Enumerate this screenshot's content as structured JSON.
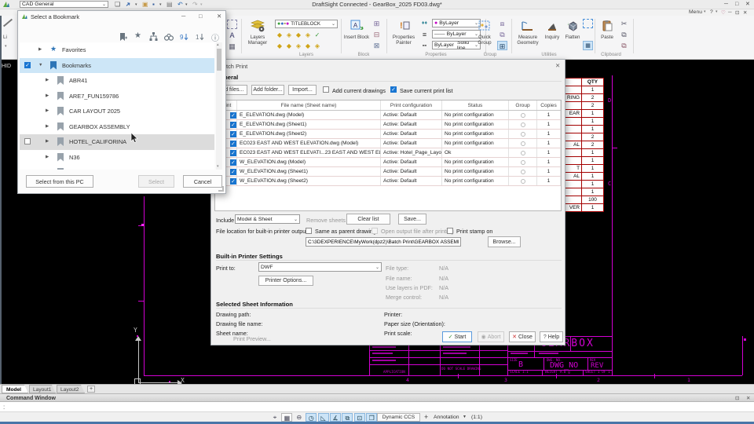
{
  "window": {
    "workspace": "CAD General",
    "title": "DraftSight Connected - GearBox_2025 FD03.dwg*",
    "menu": "Menu",
    "help": "?"
  },
  "ribbon": {
    "line_tool": "Li",
    "layers_manager": "Layers Manager",
    "layer_combo": "TITLEBLOCK",
    "insert_block": "Insert Block",
    "properties_painter": "Properties Painter",
    "color_combo": "ByLayer",
    "lineweight_combo": "ByLayer",
    "linetype_combo": "ByLayer",
    "linetype_style": "Solid line",
    "quick_group": "Quick Group",
    "measure_geometry": "Measure Geometry",
    "inquiry": "Inquiry",
    "flatten": "Flatten",
    "paste": "Paste",
    "group_labels": {
      "layers": "Layers",
      "block": "Block",
      "properties": "Properties",
      "group": "Group",
      "utilities": "Utilities",
      "clipboard": "Clipboard"
    }
  },
  "bookmark_dialog": {
    "title": "Select a Bookmark",
    "tree": [
      {
        "label": "Favorites",
        "icon": "star",
        "level": 1,
        "expanded": false
      },
      {
        "label": "Bookmarks",
        "icon": "bookmark-blue",
        "level": 1,
        "expanded": true,
        "checkbox": true,
        "selected": true
      },
      {
        "label": "ABR41",
        "icon": "bookmark",
        "level": 2,
        "expanded": false
      },
      {
        "label": "ARE7_FUN159786",
        "icon": "bookmark",
        "level": 2,
        "expanded": false
      },
      {
        "label": "CAR LAYOUT 2025",
        "icon": "bookmark",
        "level": 2,
        "expanded": false
      },
      {
        "label": "GEARBOX ASSEMBLY",
        "icon": "bookmark",
        "level": 2,
        "expanded": false
      },
      {
        "label": "HOTEL_CALIFORINA",
        "icon": "bookmark",
        "level": 2,
        "expanded": false,
        "checkbox": false,
        "hover": true
      },
      {
        "label": "N36",
        "icon": "bookmark",
        "level": 2,
        "expanded": false
      },
      {
        "label": "",
        "icon": "bookmark",
        "level": 2,
        "expanded": false
      }
    ],
    "select_from_pc": "Select from this PC",
    "select": "Select",
    "cancel": "Cancel"
  },
  "batch_print": {
    "title": "Batch Print",
    "general": "General",
    "add_files": "Add files...",
    "add_folder": "Add folder...",
    "import": "Import...",
    "add_current": "Add current drawings",
    "save_list": "Save current print list",
    "table": {
      "headers": [
        "Print",
        "File name (Sheet name)",
        "Print configuration",
        "Status",
        "Group",
        "Copies"
      ],
      "rows": [
        {
          "file": "E_ELEVATION.dwg (Model)",
          "config": "Active: Default",
          "status": "No print configuration",
          "copies": "1"
        },
        {
          "file": "E_ELEVATION.dwg (Sheet1)",
          "config": "Active: Default",
          "status": "No print configuration",
          "copies": "1"
        },
        {
          "file": "E_ELEVATION.dwg (Sheet2)",
          "config": "Active: Default",
          "status": "No print configuration",
          "copies": "1"
        },
        {
          "file": "EC023 EAST AND WEST ELEVATION.dwg (Model)",
          "config": "Active: Default",
          "status": "No print configuration",
          "copies": "1"
        },
        {
          "file": "EC023 EAST AND WEST ELEVATI...23 EAST AND WEST ELEVATION)",
          "config": "Active: Hotel_Page_Layout",
          "status": "Ok",
          "copies": "1"
        },
        {
          "file": "W_ELEVATION.dwg (Model)",
          "config": "Active: Default",
          "status": "No print configuration",
          "copies": "1"
        },
        {
          "file": "W_ELEVATION.dwg (Sheet1)",
          "config": "Active: Default",
          "status": "No print configuration",
          "copies": "1"
        },
        {
          "file": "W_ELEVATION.dwg (Sheet2)",
          "config": "Active: Default",
          "status": "No print configuration",
          "copies": "1"
        }
      ]
    },
    "include_label": "Include",
    "include_value": "Model & Sheet",
    "remove_sheets": "Remove sheets",
    "clear_list": "Clear list",
    "save": "Save...",
    "file_location_label": "File location for built-in printer output:",
    "same_as_parent": "Same as parent drawing",
    "open_output": "Open output file after printing",
    "print_stamp": "Print stamp on",
    "output_path": "C:\\3DEXPERIENCE\\MyWork(dpz2)\\Batch Print\\GEARBOX ASSEMBLY\\",
    "browse": "Browse...",
    "builtin_header": "Built-in Printer Settings",
    "print_to_label": "Print to:",
    "print_to_value": "DWF",
    "printer_options": "Printer Options...",
    "file_type_label": "File type:",
    "file_name_label": "File name:",
    "use_layers_label": "Use layers in PDF:",
    "merge_label": "Merge control:",
    "file_type_value": "N/A",
    "file_name_value": "N/A",
    "use_layers_value": "N/A",
    "merge_value": "N/A",
    "selected_header": "Selected Sheet Information",
    "drawing_path_label": "Drawing path:",
    "drawing_file_label": "Drawing file name:",
    "sheet_name_label": "Sheet name:",
    "printer_label": "Printer:",
    "paper_label": "Paper size (Orientation):",
    "print_scale_label": "Print scale:",
    "print_preview": "Print Preview...",
    "start": "Start",
    "abort": "Abort",
    "close": "Close",
    "help": "Help"
  },
  "canvas": {
    "clipped_text": "HID",
    "qty_table": {
      "header": "QTY",
      "rows": [
        {
          "name": "",
          "qty": "1"
        },
        {
          "name": "RING",
          "qty": "2"
        },
        {
          "name": "",
          "qty": "2"
        },
        {
          "name": "EAR",
          "qty": "1"
        },
        {
          "name": "",
          "qty": "1"
        },
        {
          "name": "",
          "qty": "1"
        },
        {
          "name": "",
          "qty": "2"
        },
        {
          "name": "AL",
          "qty": "2"
        },
        {
          "name": "",
          "qty": "1"
        },
        {
          "name": "",
          "qty": "1"
        },
        {
          "name": "T",
          "qty": "1"
        },
        {
          "name": "AL",
          "qty": "1"
        },
        {
          "name": "",
          "qty": "1"
        },
        {
          "name": "",
          "qty": "1"
        },
        {
          "name": "",
          "qty": "100"
        },
        {
          "name": "VER",
          "qty": "1"
        }
      ]
    },
    "zone_letters": [
      "D",
      "C"
    ],
    "zone_numbers": [
      "4",
      "3",
      "2",
      "1"
    ],
    "ucs": {
      "x": "X",
      "y": "Y"
    },
    "title_block": {
      "title": "GEARBOX",
      "size_label": "SIZE",
      "size": "B",
      "dwg_label": "DWG. NO.",
      "dwg_no": "DWG_NO",
      "rev_label": "REV",
      "rev": "REV",
      "scale": "SCALE 1:1",
      "weight": "WEIGHT 9.0 g",
      "sheet": "SHEET 1 OF 1",
      "application": "APPLICATION",
      "no_scale": "DO NOT SCALE DRAWING"
    }
  },
  "tabs": {
    "items": [
      "Model",
      "Layout1",
      "Layout2"
    ],
    "add": "+"
  },
  "command_window": {
    "title": "Command Window",
    "prompt": ":"
  },
  "status_bar": {
    "icons": [
      {
        "glyph": "⌖",
        "name": "snap-cursor-icon",
        "active": false,
        "boxed": false
      },
      {
        "glyph": "▦",
        "name": "grid-icon",
        "active": false,
        "boxed": true
      },
      {
        "glyph": "⊖",
        "name": "ortho-icon",
        "active": false,
        "boxed": false
      },
      {
        "glyph": "◷",
        "name": "polar-tracking-icon",
        "active": true,
        "boxed": false
      },
      {
        "glyph": "◺",
        "name": "entity-snap-icon",
        "active": true,
        "boxed": false
      },
      {
        "glyph": "∡",
        "name": "entity-tracking-icon",
        "active": true,
        "boxed": false
      },
      {
        "glyph": "⧉",
        "name": "selection-window-icon",
        "active": true,
        "boxed": false
      },
      {
        "glyph": "⊡",
        "name": "dynamic-input-icon",
        "active": true,
        "boxed": false
      },
      {
        "glyph": "❒",
        "name": "3d-workspace-icon",
        "active": true,
        "boxed": false
      }
    ],
    "dynamic_ccs": "Dynamic CCS",
    "plus": "+",
    "annotation": "Annotation",
    "scale": "(1:1)"
  },
  "colors": {
    "accent": "#1976d2",
    "magenta": "#d400d4",
    "selection": "#cde6f7"
  }
}
